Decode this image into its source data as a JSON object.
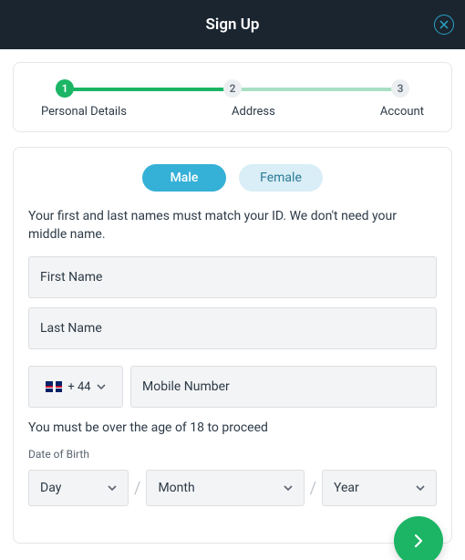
{
  "header": {
    "title": "Sign Up"
  },
  "stepper": {
    "steps": [
      {
        "num": "1",
        "label": "Personal Details"
      },
      {
        "num": "2",
        "label": "Address"
      },
      {
        "num": "3",
        "label": "Account"
      }
    ]
  },
  "gender": {
    "male": "Male",
    "female": "Female"
  },
  "name_hint": "Your first and last names must match your ID. We don't need your middle name.",
  "first_name": {
    "placeholder": "First Name",
    "value": ""
  },
  "last_name": {
    "placeholder": "Last Name",
    "value": ""
  },
  "phone": {
    "country_code": "+ 44",
    "placeholder": "Mobile Number",
    "value": ""
  },
  "age_note": "You must be over the age of 18 to proceed",
  "dob": {
    "label": "Date of Birth",
    "day": "Day",
    "month": "Month",
    "year": "Year"
  }
}
